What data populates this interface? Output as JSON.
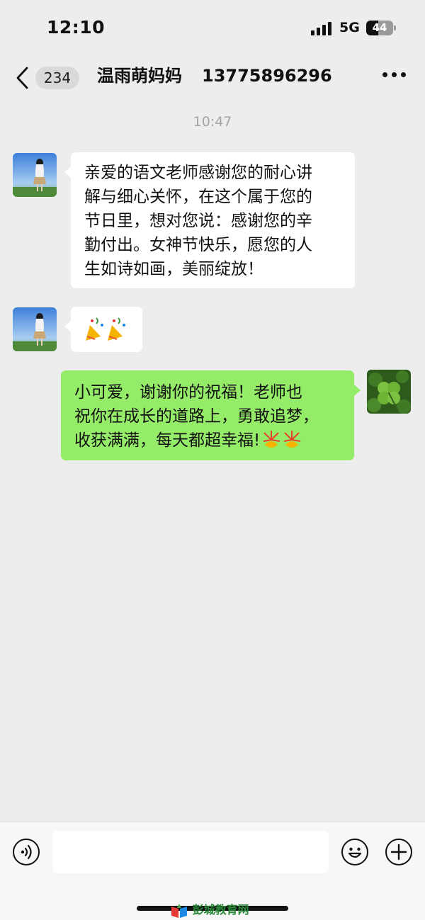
{
  "status_bar": {
    "time": "12:10",
    "network": "5G",
    "battery": "44"
  },
  "nav": {
    "unread_count": "234",
    "contact_name": "温雨萌妈妈",
    "contact_phone": "13775896296"
  },
  "timestamp": "10:47",
  "messages": [
    {
      "side": "left",
      "lines": [
        "亲爱的语文老师感谢您的耐心讲",
        "解与细心关怀，在这个属于您的",
        "节日里，想对您说：感谢您的辛",
        "勤付出。女神节快乐，愿您的人",
        "生如诗如画，美丽绽放！"
      ]
    },
    {
      "side": "left",
      "emoji": "🎉🎉"
    },
    {
      "side": "right",
      "lines": [
        "小可爱，谢谢你的祝福！老师也",
        "祝你在成长的道路上，勇敢追梦，",
        "收获满满，每天都超幸福!"
      ],
      "trailing_emoji": "🎊🎊"
    }
  ],
  "input": {
    "value": "",
    "placeholder": ""
  },
  "watermark": "彭城教育网",
  "icons": [
    "back-arrow-icon",
    "more-icon",
    "voice-icon",
    "emoji-icon",
    "plus-icon"
  ],
  "colors": {
    "background": "#ededed",
    "incoming_bubble": "#ffffff",
    "outgoing_bubble": "#95ec69",
    "timestamp": "#a4a4a4"
  }
}
